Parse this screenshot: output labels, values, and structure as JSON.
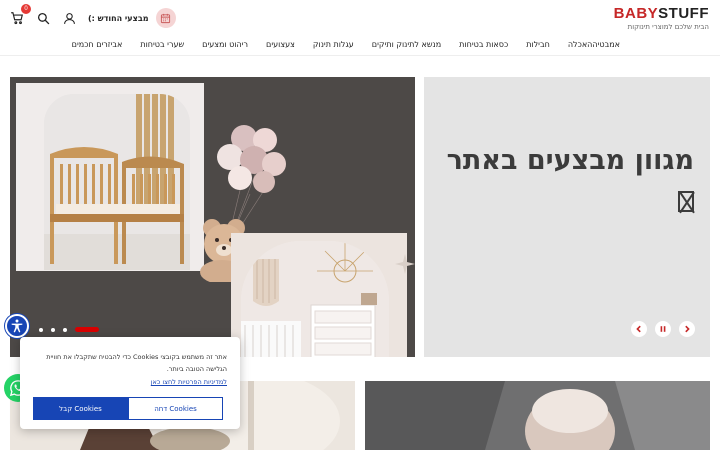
{
  "header": {
    "logo": {
      "part1": "BABY",
      "part2": "STUFF",
      "tagline": "הבית שלכם למוצרי תינוקות"
    },
    "promo_text": "מבצעי החודש :)",
    "cart_count": "0",
    "icons": [
      "cart-icon",
      "search-icon",
      "user-icon",
      "promo-calendar-icon"
    ]
  },
  "nav": {
    "items": [
      {
        "label": "אמבטיה"
      },
      {
        "label": "האכלה"
      },
      {
        "label": "חבילות"
      },
      {
        "label": "כסאות בטיחות"
      },
      {
        "label": "מנשא לתינוק ותיקים"
      },
      {
        "label": "עגלות תינוק"
      },
      {
        "label": "צעצועים"
      },
      {
        "label": "ריהוט ומצעים"
      },
      {
        "label": "שערי בטיחות"
      },
      {
        "label": "אביזרים חכמים"
      }
    ]
  },
  "hero": {
    "heading": "מגוון מבצעים באתר",
    "slides_total": 4,
    "active_slide": 4
  },
  "cookie": {
    "text": "אתר זה משתמש בקובצי Cookies כדי להבטיח שתקבלו את חוויית הגלישה הטובה ביותר.",
    "privacy_link": "למדיניות הפרטיות לחצו כאן",
    "reject_label": "דחה Cookies",
    "accept_label": "קבל Cookies"
  },
  "colors": {
    "brand_red": "#c62828",
    "accent_blue": "#1745b5",
    "badge_red": "#e53935",
    "slider_active": "#d90000",
    "whatsapp_green": "#25d366"
  }
}
